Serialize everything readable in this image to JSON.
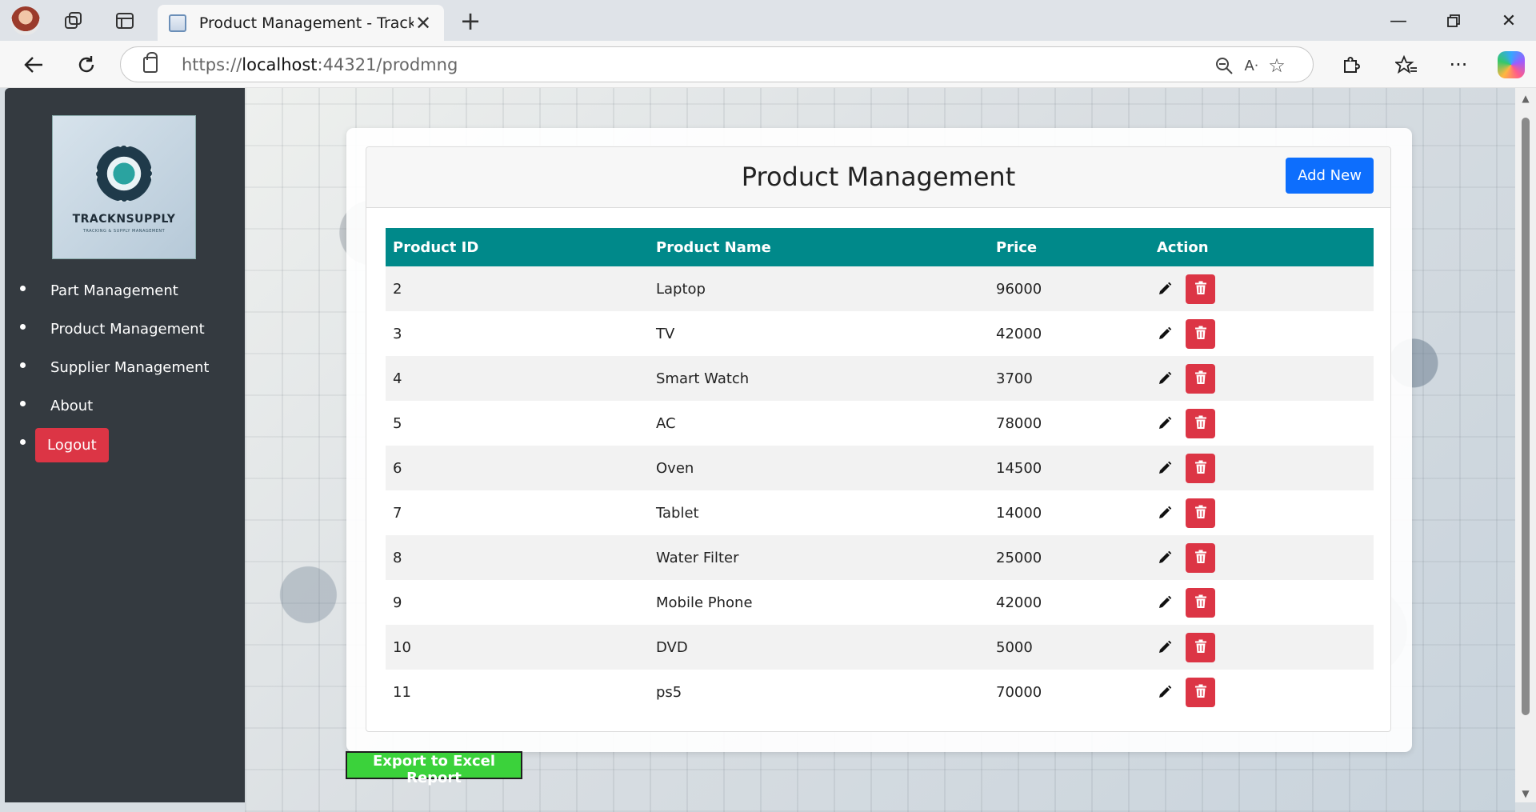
{
  "browser": {
    "tab_title": "Product Management - TracknSupply",
    "url_scheme": "https://",
    "url_host": "localhost",
    "url_rest": ":44321/prodmng"
  },
  "sidebar": {
    "logo_text": "TRACKNSUPPLY",
    "logo_subtext": "TRACKING & SUPPLY MANAGEMENT",
    "items": [
      {
        "label": "Part Management"
      },
      {
        "label": "Product Management"
      },
      {
        "label": "Supplier Management"
      },
      {
        "label": "About"
      }
    ],
    "logout_label": "Logout"
  },
  "main": {
    "title": "Product Management",
    "add_new_label": "Add New",
    "export_label": "Export to Excel Report",
    "columns": [
      "Product ID",
      "Product Name",
      "Price",
      "Action"
    ],
    "rows": [
      {
        "id": "2",
        "name": "Laptop",
        "price": "96000"
      },
      {
        "id": "3",
        "name": "TV",
        "price": "42000"
      },
      {
        "id": "4",
        "name": "Smart Watch",
        "price": "3700"
      },
      {
        "id": "5",
        "name": "AC",
        "price": "78000"
      },
      {
        "id": "6",
        "name": "Oven",
        "price": "14500"
      },
      {
        "id": "7",
        "name": "Tablet",
        "price": "14000"
      },
      {
        "id": "8",
        "name": "Water Filter",
        "price": "25000"
      },
      {
        "id": "9",
        "name": "Mobile Phone",
        "price": "42000"
      },
      {
        "id": "10",
        "name": "DVD",
        "price": "5000"
      },
      {
        "id": "11",
        "name": "ps5",
        "price": "70000"
      }
    ]
  },
  "colors": {
    "sidebar": "#343a40",
    "table_header": "#00898a",
    "primary": "#0d6efd",
    "danger": "#dc3545",
    "export": "#3bd23b"
  }
}
